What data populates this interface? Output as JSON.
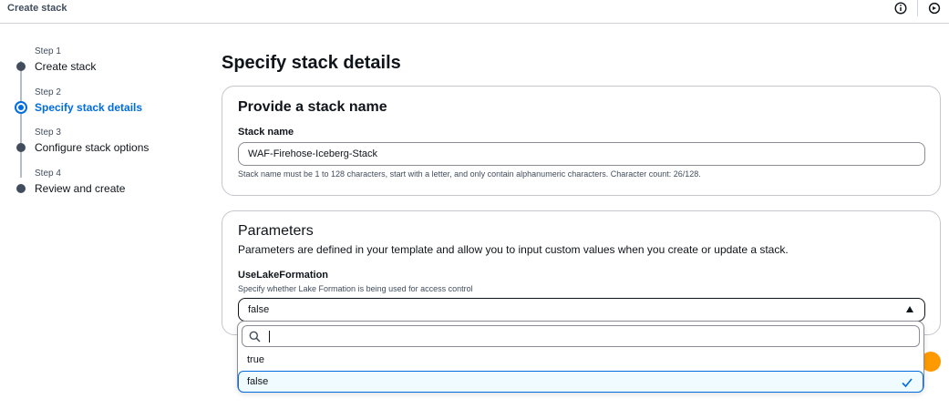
{
  "header": {
    "title": "Create stack",
    "icons": [
      "info-icon",
      "tool-icon"
    ]
  },
  "steps": [
    {
      "number": "Step 1",
      "label": "Create stack",
      "state": "complete"
    },
    {
      "number": "Step 2",
      "label": "Specify stack details",
      "state": "active"
    },
    {
      "number": "Step 3",
      "label": "Configure stack options",
      "state": "pending"
    },
    {
      "number": "Step 4",
      "label": "Review and create",
      "state": "pending"
    }
  ],
  "main": {
    "title": "Specify stack details",
    "stack_name_card": {
      "heading": "Provide a stack name",
      "field_label": "Stack name",
      "value": "WAF-Firehose-Iceberg-Stack",
      "hint": "Stack name must be 1 to 128 characters, start with a letter, and only contain alphanumeric characters. Character count: 26/128."
    },
    "parameters_card": {
      "heading": "Parameters",
      "description": "Parameters are defined in your template and allow you to input custom values when you create or update a stack.",
      "param_label": "UseLakeFormation",
      "param_description": "Specify whether Lake Formation is being used for access control",
      "selected_value": "false"
    }
  },
  "dropdown": {
    "search_value": "",
    "options": [
      "true",
      "false"
    ],
    "selected": "false"
  },
  "colors": {
    "accent": "#006ce0",
    "text": "#0f141a",
    "secondary_text": "#414d5c",
    "border": "#8c8c94",
    "primary_button": "#ff9900"
  }
}
